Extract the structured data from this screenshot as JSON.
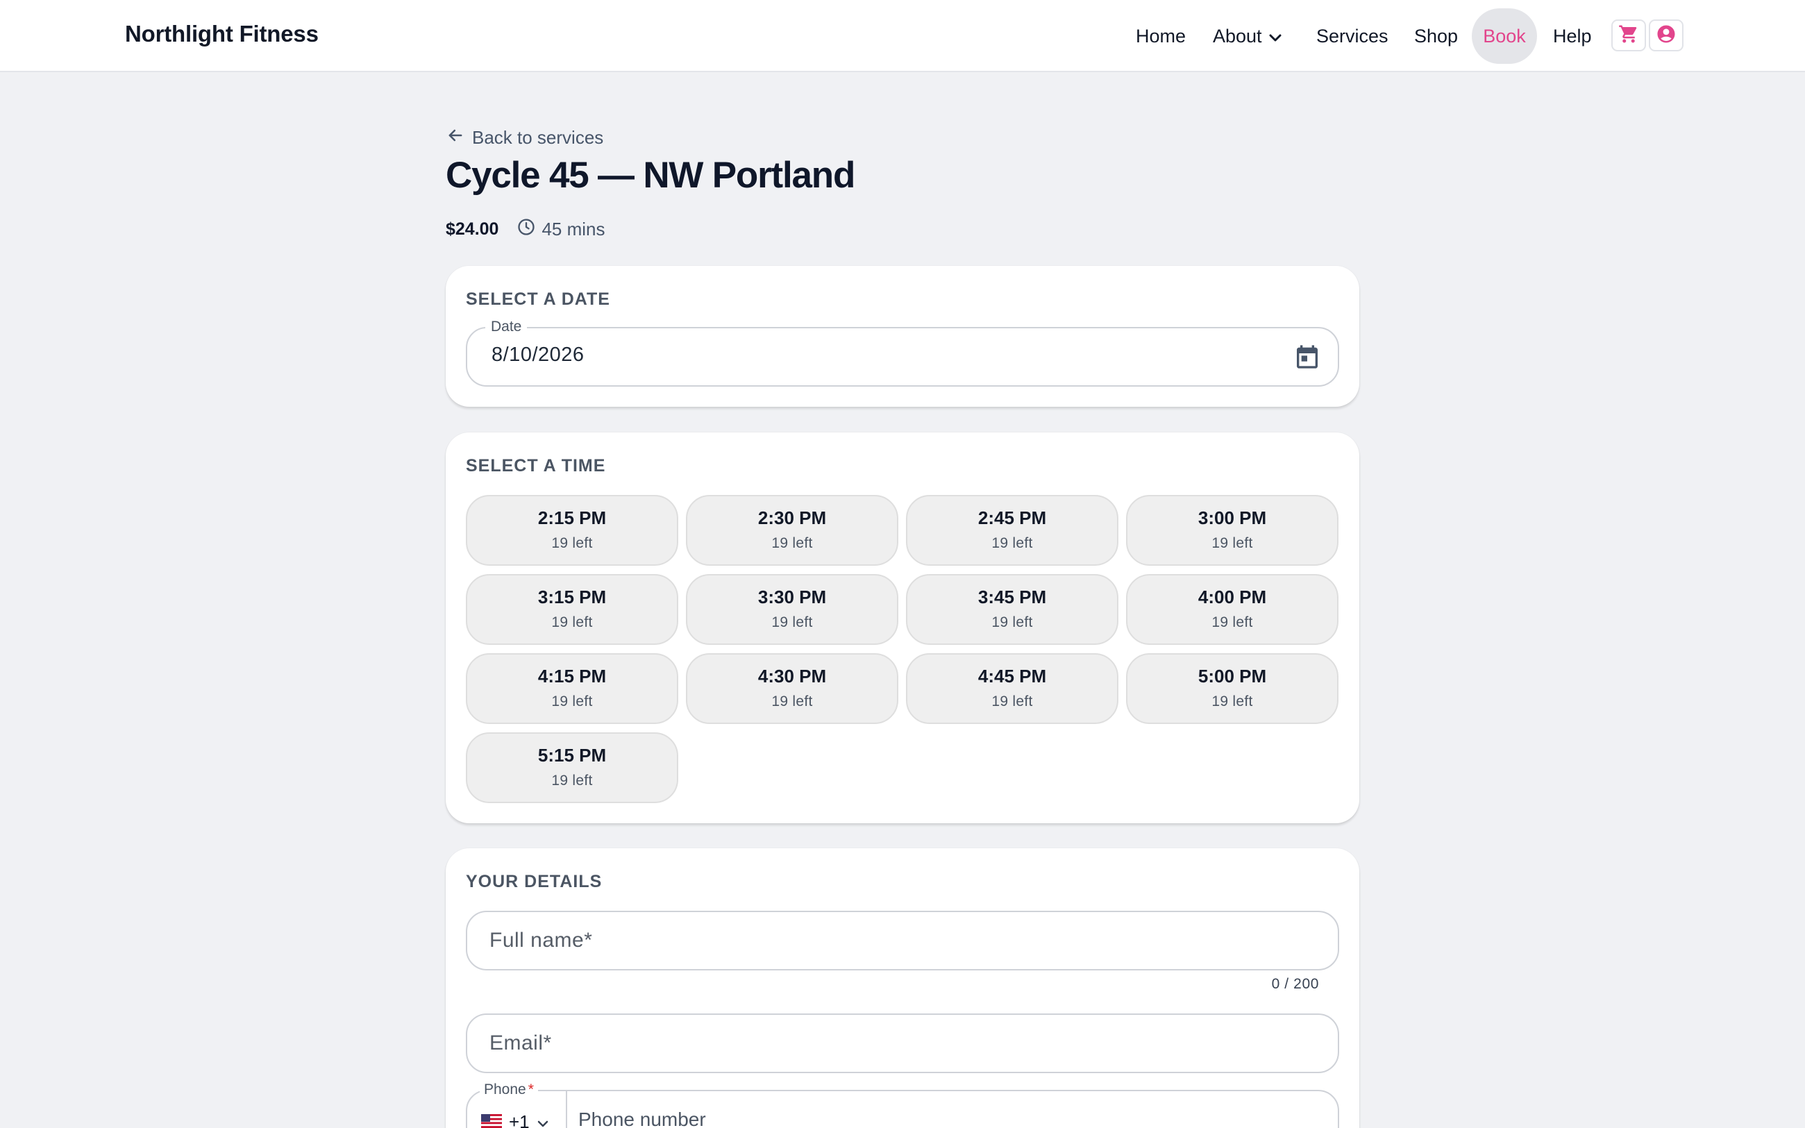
{
  "header": {
    "brand": "Northlight Fitness",
    "nav": [
      {
        "label": "Home"
      },
      {
        "label": "About"
      },
      {
        "label": "Services"
      },
      {
        "label": "Shop"
      },
      {
        "label": "Book",
        "active": true
      },
      {
        "label": "Help"
      }
    ],
    "icons": [
      "cart-icon",
      "account-icon"
    ],
    "accent_color": "#e2458c"
  },
  "service": {
    "back_label": "Back to services",
    "title": "Cycle 45 — NW Portland",
    "price": "$24.00",
    "duration": "45 mins"
  },
  "date_section": {
    "heading": "SELECT A DATE",
    "field_label": "Date",
    "value": "8/10/2026"
  },
  "time_section": {
    "heading": "SELECT A TIME",
    "slots": [
      {
        "time": "2:15 PM",
        "left": "19 left"
      },
      {
        "time": "2:30 PM",
        "left": "19 left"
      },
      {
        "time": "2:45 PM",
        "left": "19 left"
      },
      {
        "time": "3:00 PM",
        "left": "19 left"
      },
      {
        "time": "3:15 PM",
        "left": "19 left"
      },
      {
        "time": "3:30 PM",
        "left": "19 left"
      },
      {
        "time": "3:45 PM",
        "left": "19 left"
      },
      {
        "time": "4:00 PM",
        "left": "19 left"
      },
      {
        "time": "4:15 PM",
        "left": "19 left"
      },
      {
        "time": "4:30 PM",
        "left": "19 left"
      },
      {
        "time": "4:45 PM",
        "left": "19 left"
      },
      {
        "time": "5:00 PM",
        "left": "19 left"
      },
      {
        "time": "5:15 PM",
        "left": "19 left"
      }
    ]
  },
  "details_section": {
    "heading": "YOUR DETAILS",
    "full_name": {
      "value": "",
      "placeholder": "Full name*",
      "counter": "0 / 200"
    },
    "email": {
      "value": "",
      "placeholder": "Email*"
    },
    "phone": {
      "label": "Phone",
      "required_mark": "*",
      "country_code": "+1",
      "country_flag": "us-flag-icon",
      "value": "",
      "placeholder": "Phone number"
    }
  }
}
